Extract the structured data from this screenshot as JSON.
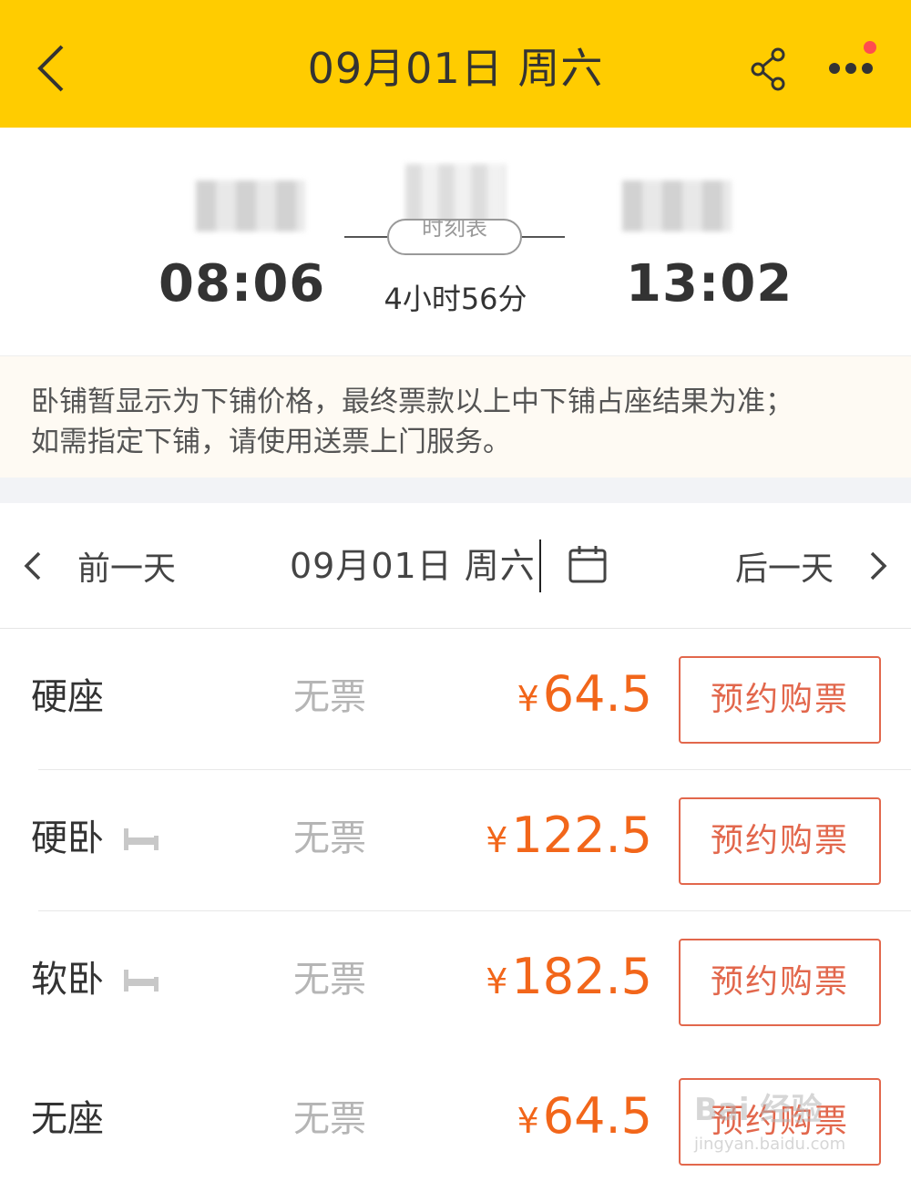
{
  "header": {
    "title": "09月01日 周六",
    "has_notification": true
  },
  "trip": {
    "depart_time": "08:06",
    "arrive_time": "13:02",
    "duration": "4小时56分",
    "timetable_label": "时刻表"
  },
  "notice": {
    "line1": "卧铺暂显示为下铺价格，最终票款以上中下铺占座结果为准；",
    "line2": "如需指定下铺，请使用送票上门服务。"
  },
  "datebar": {
    "prev_label": "前一天",
    "current_date": "09月01日 周六",
    "next_label": "后一天"
  },
  "seats": [
    {
      "name": "硬座",
      "availability": "无票",
      "currency": "¥",
      "price": "64.5",
      "button": "预约购票",
      "sleeper": false
    },
    {
      "name": "硬卧",
      "availability": "无票",
      "currency": "¥",
      "price": "122.5",
      "button": "预约购票",
      "sleeper": true
    },
    {
      "name": "软卧",
      "availability": "无票",
      "currency": "¥",
      "price": "182.5",
      "button": "预约购票",
      "sleeper": true
    },
    {
      "name": "无座",
      "availability": "无票",
      "currency": "¥",
      "price": "64.5",
      "button": "预约购票",
      "sleeper": false
    }
  ],
  "watermark": {
    "text": "Bai 经验",
    "sub": "jingyan.baidu.com"
  },
  "colors": {
    "header_bg": "#ffcc00",
    "price": "#f2661a",
    "button_border": "#e2674c",
    "notice_bg": "#fefaf3"
  }
}
